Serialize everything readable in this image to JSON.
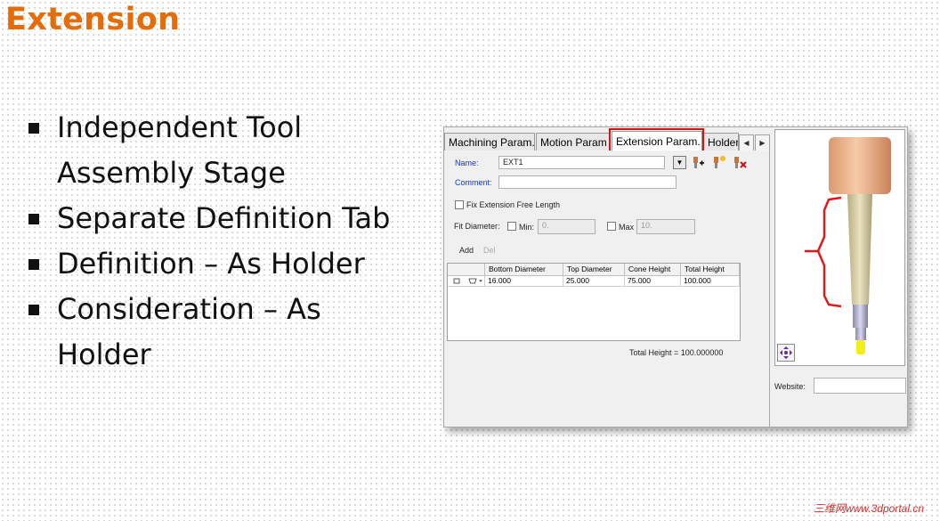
{
  "title": "Extension",
  "bullets": [
    "Independent Tool Assembly Stage",
    "Separate Definition Tab",
    "Definition – As Holder",
    "Consideration – As Holder"
  ],
  "dialog": {
    "tabs": [
      "Machining Param.",
      "Motion Param",
      "Extension Param.",
      "Holder"
    ],
    "active_tab": "Extension Param.",
    "scroll_left": "◀",
    "scroll_right": "▶",
    "name_label": "Name:",
    "name_value": "EXT1",
    "dropdown_glyph": "▼",
    "comment_label": "Comment:",
    "comment_value": "",
    "fix_length_label": "Fix Extension Free Length",
    "fit_diameter_label": "Fit Diameter:",
    "min_label": "Min:",
    "min_value": "0.",
    "max_label": "Max",
    "max_value": "10.",
    "add_label": "Add",
    "del_label": "Del",
    "columns": [
      "Bottom Diameter",
      "Top Diameter",
      "Cone Height",
      "Total Height"
    ],
    "rows": [
      {
        "bottom_diameter": "16.000",
        "top_diameter": "25.000",
        "cone_height": "75.000",
        "total_height": "100.000"
      }
    ],
    "total_height_text": "Total Height = 100.000000",
    "website_label": "Website:",
    "website_value": ""
  },
  "icons": [
    "add-extension-icon",
    "new-extension-icon",
    "delete-extension-icon",
    "pan-icon"
  ],
  "colors": {
    "title": "#e46c0a",
    "highlight": "#e01010",
    "label_blue": "#1a33c8"
  },
  "watermark": "三维网www.3dportal.cn"
}
